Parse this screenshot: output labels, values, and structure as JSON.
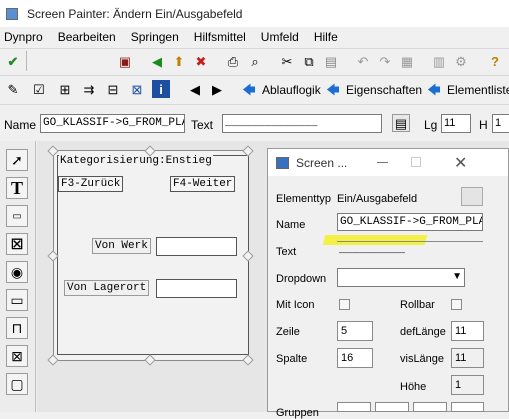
{
  "window": {
    "title": "Screen Painter: Ändern Ein/Ausgabefeld"
  },
  "menu": [
    "Dynpro",
    "Bearbeiten",
    "Springen",
    "Hilfsmittel",
    "Umfeld",
    "Hilfe"
  ],
  "toolbar2": {
    "ablauflogik": "Ablauflogik",
    "eigenschaften": "Eigenschaften",
    "elementliste": "Elementliste"
  },
  "namebar": {
    "name_label": "Name",
    "name_value": "GO_KLASSIF->G_FROM_PLA",
    "text_label": "Text",
    "text_value": "______________",
    "lg_label": "Lg",
    "lg_value": "11",
    "h_label": "H",
    "h_value": "1"
  },
  "screen": {
    "frame_title": "Kategorisierung:Enstieg",
    "btn_back": "F3-Zurück",
    "btn_next": "F4-Weiter",
    "label_werk": "Von Werk",
    "label_lagerort": "Von Lagerort"
  },
  "popup": {
    "title": "Screen ...",
    "elementtyp_label": "Elementtyp",
    "elementtyp_value": "Ein/Ausgabefeld",
    "name_label": "Name",
    "name_value": "GO_KLASSIF->G_FROM_PLA",
    "text_label": "Text",
    "text_value": "__________",
    "dropdown_label": "Dropdown",
    "mit_icon_label": "Mit Icon",
    "rollbar_label": "Rollbar",
    "zeile_label": "Zeile",
    "zeile_value": "5",
    "deflaenge_label": "defLänge",
    "deflaenge_value": "11",
    "spalte_label": "Spalte",
    "spalte_value": "16",
    "vislaenge_label": "visLänge",
    "vislaenge_value": "11",
    "hoehe_label": "Höhe",
    "hoehe_value": "1",
    "gruppen_label": "Gruppen"
  },
  "colors": {
    "highlight": "#f5f02a",
    "accent": "#1c6fd0"
  }
}
